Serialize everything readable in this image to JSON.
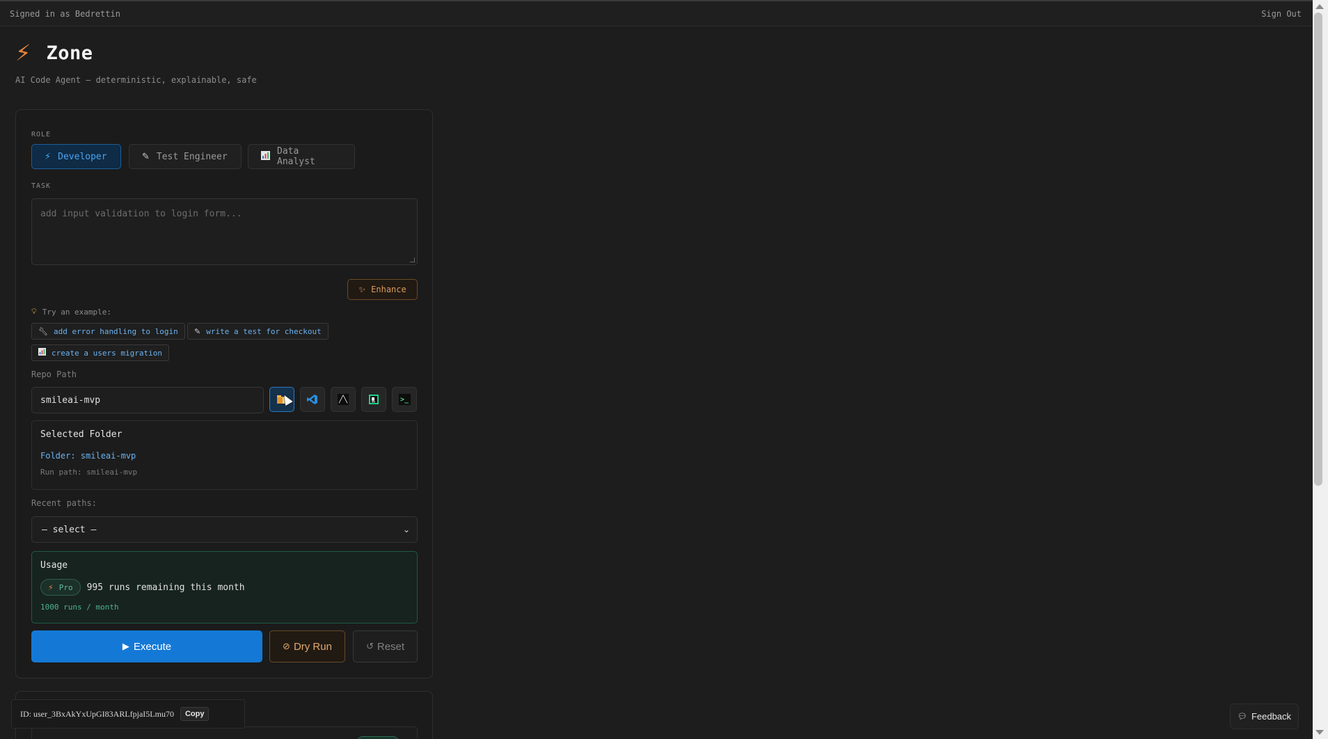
{
  "topbar": {
    "signed_in": "Signed in as Bedrettin",
    "sign_out": "Sign Out"
  },
  "app": {
    "title": "Zone",
    "subtitle": "AI Code Agent — deterministic, explainable, safe",
    "accent_color": "#e8843a"
  },
  "role": {
    "label": "ROLE",
    "selected": "Developer",
    "options": [
      {
        "label": "Developer",
        "icon": "bolt-icon"
      },
      {
        "label": "Test Engineer",
        "icon": "pencil-icon"
      },
      {
        "label": "Data Analyst",
        "icon": "bar-chart-icon"
      }
    ]
  },
  "task": {
    "label": "TASK",
    "placeholder": "add input validation to login form...",
    "value": ""
  },
  "enhance": {
    "label": "Enhance"
  },
  "examples": {
    "hint": "Try an example:",
    "items": [
      {
        "label": "add error handling to login",
        "icon": "wrench-icon"
      },
      {
        "label": "write a test for checkout",
        "icon": "pencil-icon"
      },
      {
        "label": "create a users migration",
        "icon": "bar-chart-icon"
      }
    ]
  },
  "repo": {
    "label": "Repo Path",
    "value": "smileai-mvp",
    "tools": [
      "folder-icon",
      "vscode-icon",
      "cursor-editor-icon",
      "pycharm-icon",
      "terminal-icon"
    ]
  },
  "folder": {
    "title": "Selected Folder",
    "name": "Folder: smileai-mvp",
    "run_path": "Run path: smileai-mvp"
  },
  "recent": {
    "label": "Recent paths:",
    "selected": "— select —"
  },
  "usage": {
    "title": "Usage",
    "plan": "Pro",
    "remaining": "995 runs remaining this month",
    "limit": "1000 runs / month"
  },
  "actions": {
    "execute": "Execute",
    "dry_run": "Dry Run",
    "reset": "Reset"
  },
  "user_id": {
    "text": "ID: user_3BxAkYxUpGI83ARLfpjaI5Lmu70",
    "copy": "Copy"
  },
  "feedback": {
    "label": "Feedback"
  }
}
